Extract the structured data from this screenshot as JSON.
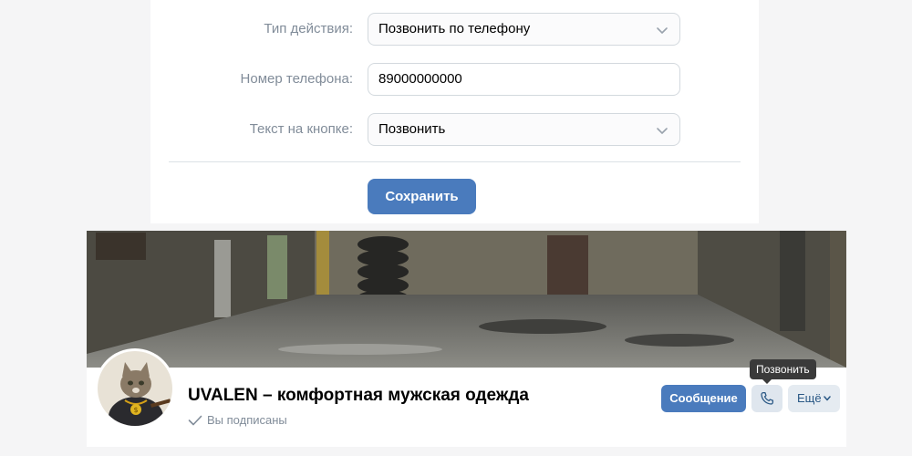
{
  "settings": {
    "action_type": {
      "label": "Тип действия:",
      "value": "Позвонить по телефону"
    },
    "phone": {
      "label": "Номер телефона:",
      "value": "89000000000"
    },
    "button_text": {
      "label": "Текст на кнопке:",
      "value": "Позвонить"
    },
    "save_label": "Сохранить"
  },
  "community": {
    "name": "UVALEN – комфортная мужская одежда",
    "subscribed_label": "Вы подписаны",
    "message_label": "Сообщение",
    "more_label": "Ещё",
    "call_tooltip": "Позвонить"
  },
  "icons": {
    "select_chevron": "chevron-down-icon",
    "subscribed_check": "check-icon",
    "call": "phone-icon",
    "more_chevron": "chevron-down-icon"
  },
  "colors": {
    "accent": "#4a7bbd",
    "label_gray": "#818c99",
    "secondary_button": "#dfe6ee",
    "tooltip_bg": "#3a3a3a"
  }
}
